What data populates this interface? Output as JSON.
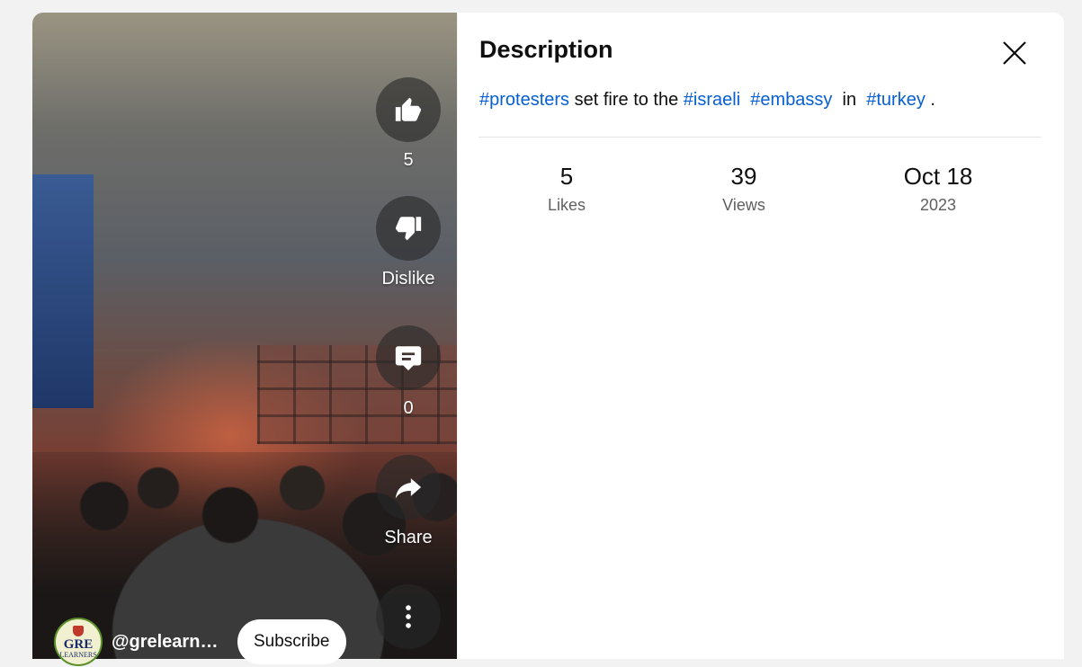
{
  "video": {
    "actions": {
      "like_count": "5",
      "dislike_label": "Dislike",
      "comment_count": "0",
      "share_label": "Share"
    },
    "channel": {
      "handle": "@grelearners",
      "avatar_text": "GRE",
      "avatar_subtext": "LEARNERS"
    },
    "subscribe_label": "Subscribe"
  },
  "description_panel": {
    "title": "Description",
    "description": {
      "tag1": "#protesters",
      "text1": " set fire to the ",
      "tag2": "#israeli",
      "tag3": "#embassy",
      "text2": " in ",
      "tag4": "#turkey",
      "text3": " ."
    },
    "stats": {
      "likes_value": "5",
      "likes_label": "Likes",
      "views_value": "39",
      "views_label": "Views",
      "date_value": "Oct 18",
      "date_year": "2023"
    }
  },
  "colors": {
    "link": "#065fd4",
    "panel_bg": "#ffffff",
    "action_circle": "#282828"
  },
  "icons": [
    "thumbs-up-icon",
    "thumbs-down-icon",
    "comment-icon",
    "share-icon",
    "more-vert-icon",
    "close-icon"
  ]
}
